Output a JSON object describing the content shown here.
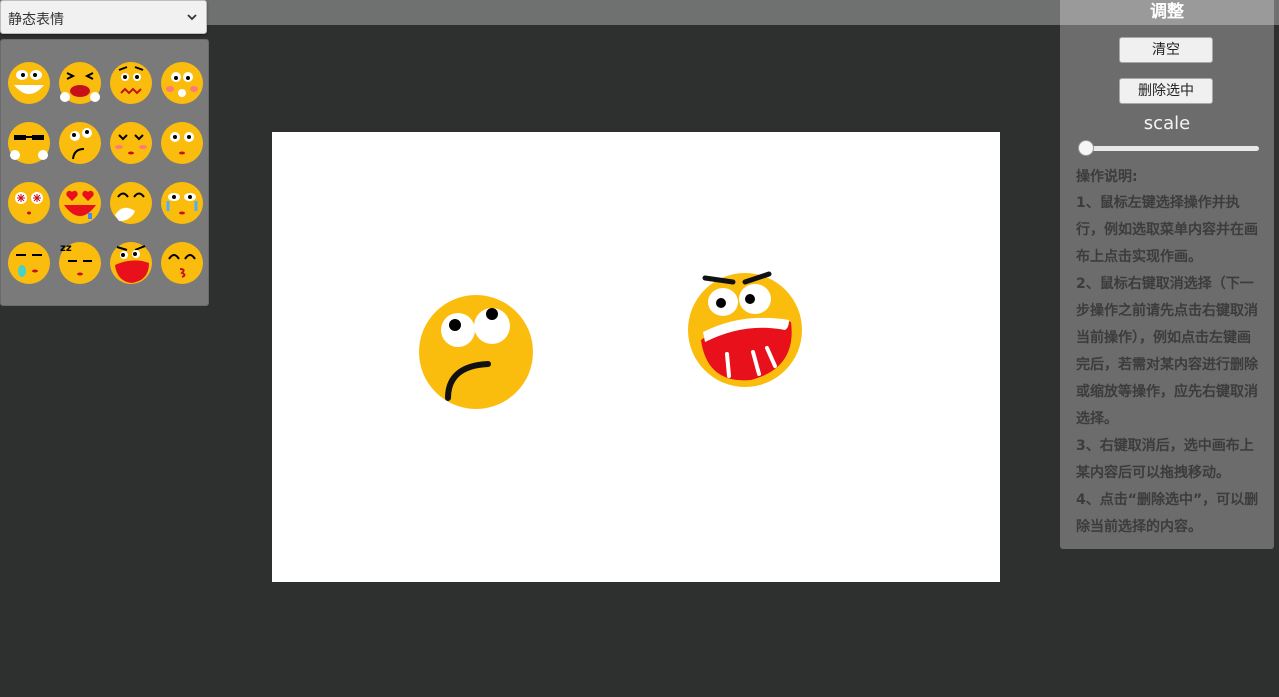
{
  "dropdown": {
    "selected": "静态表情"
  },
  "emoji_palette": {
    "items": [
      "grin-emoji",
      "squint-cry-emoji",
      "worried-emoji",
      "blush-eyes-emoji",
      "sunglasses-emoji",
      "confused-emoji",
      "sleepy-blush-emoji",
      "surprised-emoji",
      "dizzy-emoji",
      "heart-eyes-emoji",
      "laugh-cover-emoji",
      "tearful-emoji",
      "snot-emoji",
      "sleeping-emoji",
      "angry-shout-emoji",
      "kiss-emoji"
    ]
  },
  "canvas": {
    "placed": [
      "confused-emoji",
      "angry-shout-emoji"
    ]
  },
  "side_panel": {
    "title": "调整",
    "clear_label": "清空",
    "delete_label": "删除选中",
    "scale_label": "scale",
    "scale_value": 0.0,
    "instructions_title": "操作说明:",
    "instructions": [
      "1、鼠标左键选择操作并执行，例如选取菜单内容并在画布上点击实现作画。",
      "2、鼠标右键取消选择（下一步操作之前请先点击右键取消当前操作），例如点击左键画完后，若需对某内容进行删除或缩放等操作，应先右键取消选择。",
      "3、右键取消后，选中画布上某内容后可以拖拽移动。",
      "4、点击“删除选中”，可以删除当前选择的内容。"
    ]
  },
  "colors": {
    "emoji_yellow": "#fbbd0d",
    "mouth_red": "#e8101a"
  }
}
